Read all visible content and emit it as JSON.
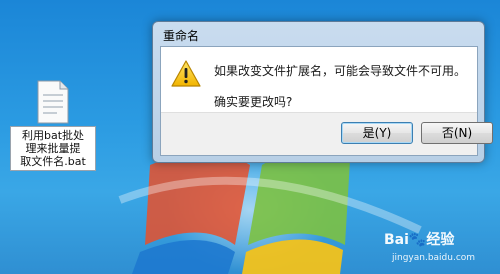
{
  "desktop": {
    "file": {
      "label_line1": "利用bat批处",
      "label_line2": "理来批量提",
      "label_line3": "取文件名.bat"
    }
  },
  "dialog": {
    "title": "重命名",
    "message_line1": "如果改变文件扩展名，可能会导致文件不可用。",
    "message_line2": "确实要更改吗?",
    "yes_button": "是(Y)",
    "no_button": "否(N)",
    "icon": "warning-icon"
  },
  "watermark": {
    "brand": "Bai🐾经验",
    "url": "jingyan.baidu.com"
  },
  "colors": {
    "desktop_blue": "#2b9be2",
    "titlebar": "#c9dcef",
    "accent_default_button": "#3c7fb1"
  }
}
